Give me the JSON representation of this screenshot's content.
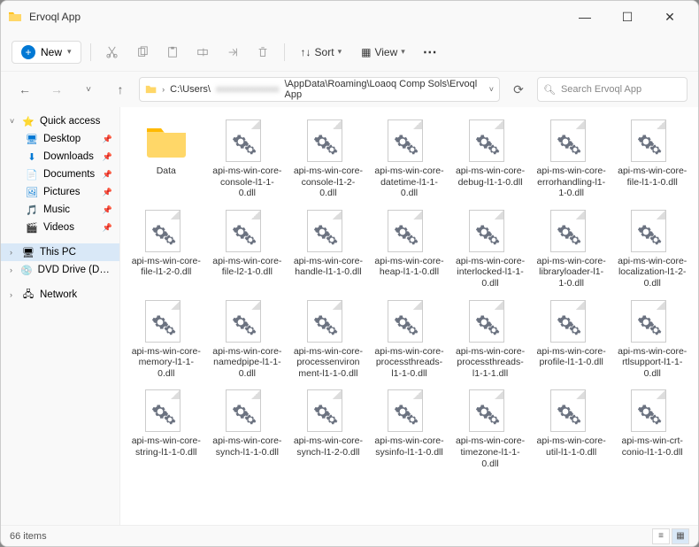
{
  "window": {
    "title": "Ervoql App"
  },
  "toolbar": {
    "new_label": "New",
    "sort_label": "Sort",
    "view_label": "View"
  },
  "address": {
    "prefix": "C:\\Users\\",
    "redacted": "xxxxxxxxxxxxx",
    "suffix": "\\AppData\\Roaming\\Loaoq Comp Sols\\Ervoql App"
  },
  "search": {
    "placeholder": "Search Ervoql App"
  },
  "sidebar": {
    "quick_access": "Quick access",
    "desktop": "Desktop",
    "downloads": "Downloads",
    "documents": "Documents",
    "pictures": "Pictures",
    "music": "Music",
    "videos": "Videos",
    "this_pc": "This PC",
    "dvd": "DVD Drive (D:) CCCC",
    "network": "Network"
  },
  "items": [
    {
      "name": "Data",
      "type": "folder"
    },
    {
      "name": "api-ms-win-core-console-l1-1-0.dll",
      "type": "dll"
    },
    {
      "name": "api-ms-win-core-console-l1-2-0.dll",
      "type": "dll"
    },
    {
      "name": "api-ms-win-core-datetime-l1-1-0.dll",
      "type": "dll"
    },
    {
      "name": "api-ms-win-core-debug-l1-1-0.dll",
      "type": "dll"
    },
    {
      "name": "api-ms-win-core-errorhandling-l1-1-0.dll",
      "type": "dll"
    },
    {
      "name": "api-ms-win-core-file-l1-1-0.dll",
      "type": "dll"
    },
    {
      "name": "api-ms-win-core-file-l1-2-0.dll",
      "type": "dll"
    },
    {
      "name": "api-ms-win-core-file-l2-1-0.dll",
      "type": "dll"
    },
    {
      "name": "api-ms-win-core-handle-l1-1-0.dll",
      "type": "dll"
    },
    {
      "name": "api-ms-win-core-heap-l1-1-0.dll",
      "type": "dll"
    },
    {
      "name": "api-ms-win-core-interlocked-l1-1-0.dll",
      "type": "dll"
    },
    {
      "name": "api-ms-win-core-libraryloader-l1-1-0.dll",
      "type": "dll"
    },
    {
      "name": "api-ms-win-core-localization-l1-2-0.dll",
      "type": "dll"
    },
    {
      "name": "api-ms-win-core-memory-l1-1-0.dll",
      "type": "dll"
    },
    {
      "name": "api-ms-win-core-namedpipe-l1-1-0.dll",
      "type": "dll"
    },
    {
      "name": "api-ms-win-core-processenvironment-l1-1-0.dll",
      "type": "dll"
    },
    {
      "name": "api-ms-win-core-processthreads-l1-1-0.dll",
      "type": "dll"
    },
    {
      "name": "api-ms-win-core-processthreads-l1-1-1.dll",
      "type": "dll"
    },
    {
      "name": "api-ms-win-core-profile-l1-1-0.dll",
      "type": "dll"
    },
    {
      "name": "api-ms-win-core-rtlsupport-l1-1-0.dll",
      "type": "dll"
    },
    {
      "name": "api-ms-win-core-string-l1-1-0.dll",
      "type": "dll"
    },
    {
      "name": "api-ms-win-core-synch-l1-1-0.dll",
      "type": "dll"
    },
    {
      "name": "api-ms-win-core-synch-l1-2-0.dll",
      "type": "dll"
    },
    {
      "name": "api-ms-win-core-sysinfo-l1-1-0.dll",
      "type": "dll"
    },
    {
      "name": "api-ms-win-core-timezone-l1-1-0.dll",
      "type": "dll"
    },
    {
      "name": "api-ms-win-core-util-l1-1-0.dll",
      "type": "dll"
    },
    {
      "name": "api-ms-win-crt-conio-l1-1-0.dll",
      "type": "dll"
    }
  ],
  "status": {
    "count": "66 items"
  }
}
